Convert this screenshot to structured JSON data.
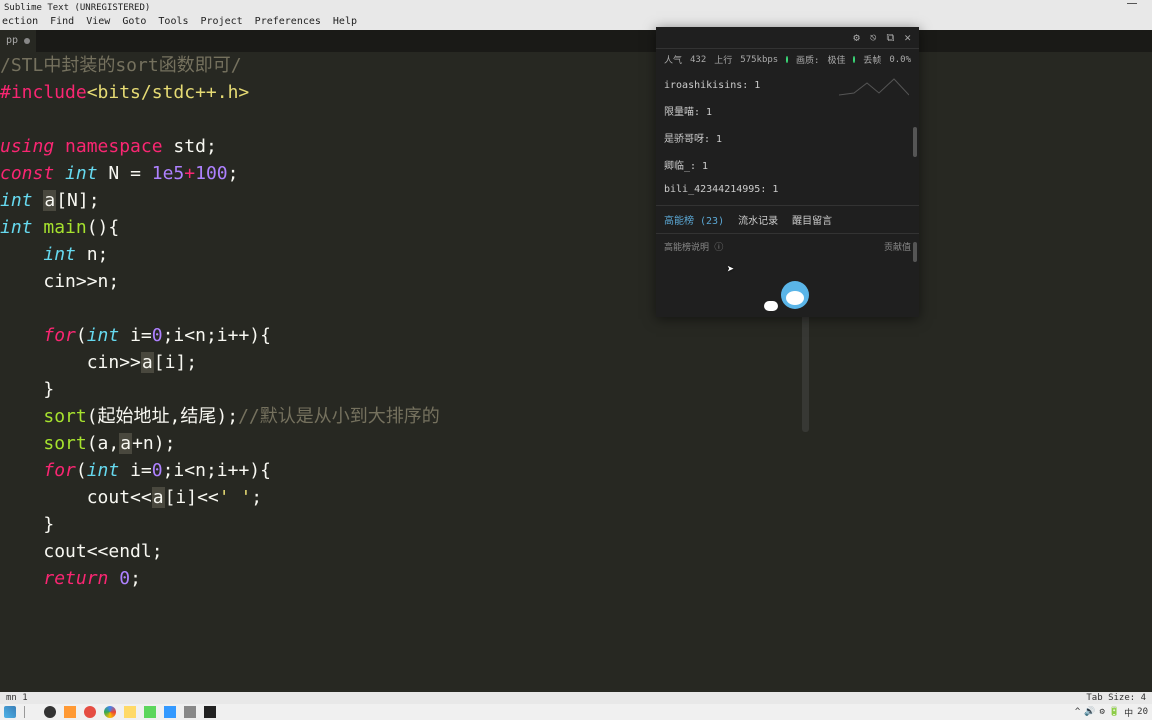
{
  "title": "Sublime Text (UNREGISTERED)",
  "menu": [
    "ection",
    "Find",
    "View",
    "Goto",
    "Tools",
    "Project",
    "Preferences",
    "Help"
  ],
  "tab": {
    "name": "pp",
    "modified": true
  },
  "code": {
    "l1_comment": "/STL中封装的sort函数即可/",
    "l2_inc": "#include",
    "l2_hdr": "<bits/stdc++.h>",
    "l4_using": "using",
    "l4_ns": "namespace",
    "l4_std": "std",
    "l5_const": "const",
    "l5_int": "int",
    "l5_N": "N",
    "l5_val": "1e5",
    "l5_plus": "+",
    "l5_100": "100",
    "l6_int": "int",
    "l6_a": "a",
    "l6_Nb": "[N];",
    "l7_int": "int",
    "l7_main": "main",
    "l8_int": "int",
    "l8_n": "n;",
    "l9": "cin>>n;",
    "l11_for": "for",
    "l11_int": "int",
    "l11_body": " i=",
    "l11_0": "0",
    "l11_rest": ";i<n;i++){",
    "l12a": "cin>>",
    "l12b": "a",
    "l12c": "[i];",
    "l13": "}",
    "l14a": "sort",
    "l14b": "(起始地址,结尾);",
    "l14c": "//默认是从小到大排序的",
    "l15a": "sort",
    "l15b": "(a,",
    "l15c": "a",
    "l15d": "+n);",
    "l16_for": "for",
    "l16_int": "int",
    "l16_body": " i=",
    "l16_0": "0",
    "l16_rest": ";i<n;i++){",
    "l17a": "cout<<",
    "l17b": "a",
    "l17c": "[i]<<",
    "l17d": "' '",
    "l17e": ";",
    "l18": "}",
    "l19": "cout<<endl;",
    "l20_ret": "return",
    "l20_0": "0",
    "l20_semi": ";"
  },
  "overlay": {
    "stats": {
      "popularity_label": "人气",
      "popularity_value": "432",
      "up_label": "上行",
      "up_value": "575kbps",
      "quality_label": "画质:",
      "quality_value": "极佳",
      "drop_label": "丢帧",
      "drop_value": "0.0%"
    },
    "users": [
      {
        "name": "iroashikisins: 1"
      },
      {
        "name": "限量喵: 1"
      },
      {
        "name": "是骄哥呀: 1"
      },
      {
        "name": "卿临_: 1"
      },
      {
        "name": "bili_42344214995: 1"
      }
    ],
    "tabs": {
      "t1": "高能榜 (23)",
      "t2": "流水记录",
      "t3": "醒目留言"
    },
    "footer": {
      "left": "高能榜说明 ⓘ",
      "right": "贡献值"
    }
  },
  "status": {
    "left": "mn 1",
    "right": "Tab Size: 4"
  },
  "tray": {
    "time": "20",
    "ime": "中",
    "net": "⚡"
  }
}
